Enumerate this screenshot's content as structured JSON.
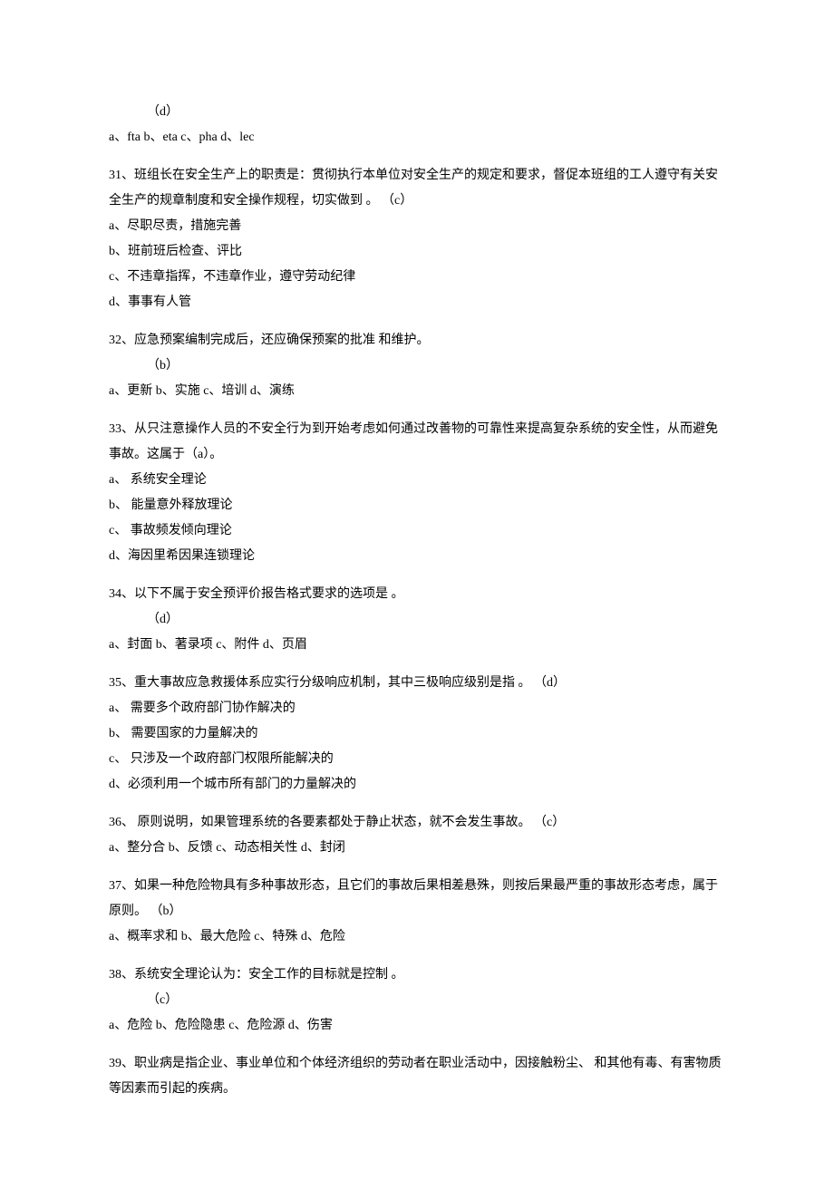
{
  "q30": {
    "answer": "（d）",
    "options": "a、fta    b、eta      c、pha       d、lec"
  },
  "q31": {
    "stem": "31、班组长在安全生产上的职责是：贯彻执行本单位对安全生产的规定和要求，督促本班组的工人遵守有关安全生产的规章制度和安全操作规程，切实做到               。               （c）",
    "a": "a、尽职尽责，措施完善",
    "b": "b、班前班后检查、评比",
    "c": "c、不违章指挥，不违章作业，遵守劳动纪律",
    "d": "d、事事有人管"
  },
  "q32": {
    "stem": "32、应急预案编制完成后，还应确保预案的批准           和维护。",
    "answer": "（b）",
    "options": "a、更新       b、实施       c、培训      d、演练"
  },
  "q33": {
    "stem": "33、从只注意操作人员的不安全行为到开始考虑如何通过改善物的可靠性来提高复杂系统的安全性，从而避免事故。这属于（a）。",
    "a": "a、    系统安全理论",
    "b": "b、    能量意外释放理论",
    "c": "c、    事故频发倾向理论",
    "d": "d、海因里希因果连锁理论"
  },
  "q34": {
    "stem": "34、以下不属于安全预评价报告格式要求的选项是        。",
    "answer": "（d）",
    "options": "a、封面      b、著录项      c、附件     d、页眉"
  },
  "q35": {
    "stem": "35、重大事故应急救援体系应实行分级响应机制，其中三极响应级别是指           。    （d）",
    "a": "a、    需要多个政府部门协作解决的",
    "b": "b、    需要国家的力量解决的",
    "c": "c、    只涉及一个政府部门权限所能解决的",
    "d": "d、必须利用一个城市所有部门的力量解决的"
  },
  "q36": {
    "stem": "36、          原则说明，如果管理系统的各要素都处于静止状态，就不会发生事故。       （c）",
    "options": "a、整分合      b、反馈      c、动态相关性       d、封闭"
  },
  "q37": {
    "stem": "37、如果一种危险物具有多种事故形态，且它们的事故后果相差悬殊，则按后果最严重的事故形态考虑，属于           原则。     （b）",
    "options": "a、概率求和      b、最大危险      c、特殊     d、危险"
  },
  "q38": {
    "stem": "38、系统安全理论认为：安全工作的目标就是控制         。",
    "answer": "（c）",
    "options": "a、危险      b、危险隐患       c、危险源      d、伤害"
  },
  "q39": {
    "stem": "39、职业病是指企业、事业单位和个体经济组织的劳动者在职业活动中，因接触粉尘、       和其他有毒、有害物质等因素而引起的疾病。"
  }
}
